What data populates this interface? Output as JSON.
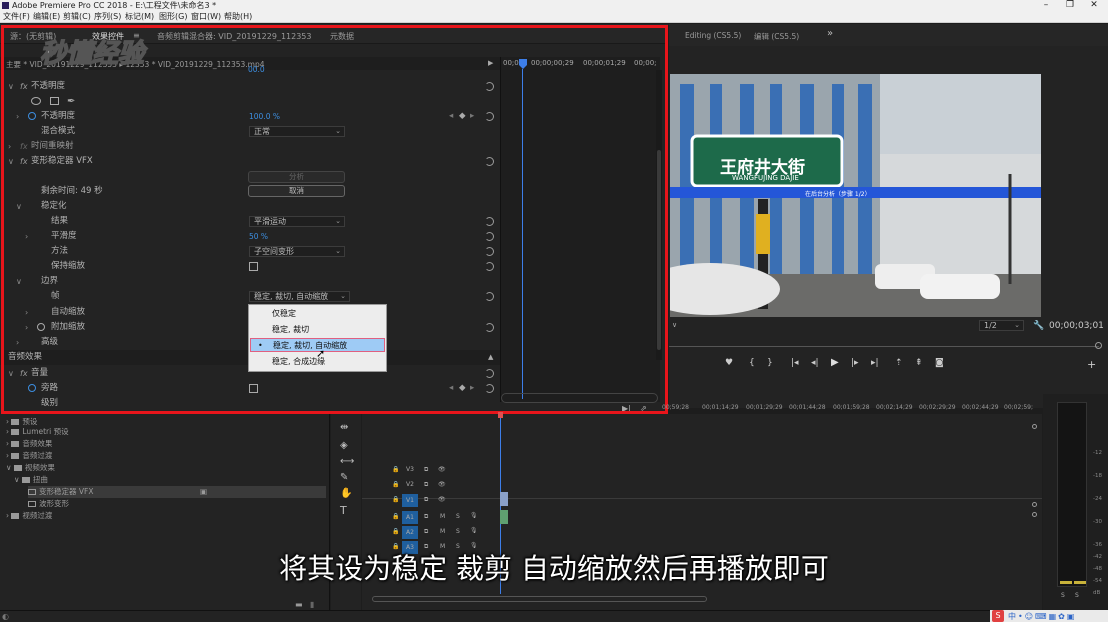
{
  "app": {
    "title": "Adobe Premiere Pro CC 2018 - E:\\工程文件\\未命名3 *"
  },
  "menu": [
    "文件(F)",
    "编辑(E)",
    "剪辑(C)",
    "序列(S)",
    "标记(M)",
    "图形(G)",
    "窗口(W)",
    "帮助(H)"
  ],
  "watermark": "秒懂经验",
  "effect_panel": {
    "tabs": {
      "source": "源：(无剪辑)",
      "effect_controls": "效果控件",
      "menu_icon": "≡",
      "audio_mixer": "音频剪辑混合器: VID_20191229_112353",
      "metadata": "元数据"
    },
    "clip_path": "主要 * VID_20191229_112353 ▸ 12353 * VID_20191229_112353.mp4",
    "timecodes": [
      "00;00",
      "00;00;00;29",
      "00;00;01;29",
      "00;00;"
    ],
    "rows": {
      "top_partial": "00.0",
      "opacity": "不透明度",
      "opacity_label": "不透明度",
      "opacity_value": "100.0 %",
      "blend_mode": "混合模式",
      "blend_mode_value": "正常",
      "time_remap": "时间重映射",
      "warp_stabilizer": "变形稳定器 VFX",
      "analyze_btn": "分析",
      "remaining": "剩余时间: 49 秒",
      "cancel_btn": "取消",
      "stabilization": "稳定化",
      "result": "结果",
      "result_value": "平滑运动",
      "smoothness": "平滑度",
      "smoothness_value": "50 %",
      "method": "方法",
      "method_value": "子空间变形",
      "preserve_scale": "保持缩放",
      "borders": "边界",
      "framing": "帧",
      "framing_value": "稳定, 裁切, 自动缩放",
      "auto_scale": "自动缩放",
      "additional_scale": "附加缩放",
      "advanced": "高级",
      "audio_effects": "音频效果",
      "volume": "音量",
      "bypass": "旁路",
      "level_partial": "级别"
    },
    "framing_menu": {
      "options": [
        "仅稳定",
        "稳定, 裁切",
        "稳定, 裁切, 自动缩放",
        "稳定, 合成边缘"
      ],
      "selected_index": 2
    }
  },
  "program_monitor": {
    "tabs": [
      "Editing (CS5.5)",
      "编辑 (CS5.5)"
    ],
    "overflow": "»",
    "overlay_text": "在后台分析（步骤 1/2）",
    "sign_main": "王府井大街",
    "sign_sub": "WANGFUJING DAJIE",
    "resolution": "1/2",
    "timecode": "00;00;03;01"
  },
  "project_panel": {
    "items": [
      {
        "label": "预设",
        "indent": 0
      },
      {
        "label": "Lumetri 预设",
        "indent": 0
      },
      {
        "label": "音频效果",
        "indent": 0
      },
      {
        "label": "音频过渡",
        "indent": 0
      },
      {
        "label": "视频效果",
        "indent": 0
      },
      {
        "label": "扭曲",
        "indent": 1
      },
      {
        "label": "变形稳定器 VFX",
        "indent": 2
      },
      {
        "label": "波形变形",
        "indent": 2
      },
      {
        "label": "视频过渡",
        "indent": 0
      }
    ]
  },
  "timeline": {
    "ruler": [
      "00;59;28",
      "00;01;14;29",
      "00;01;29;29",
      "00;01;44;28",
      "00;01;59;28",
      "00;02;14;29",
      "00;02;29;29",
      "00;02;44;29",
      "00;02;59;"
    ],
    "video_tracks": [
      "V3",
      "V2",
      "V1"
    ],
    "audio_tracks": [
      "A1",
      "A2",
      "A3"
    ],
    "mute": "M",
    "solo": "S"
  },
  "meter": {
    "scale": [
      "-12",
      "-18",
      "-24",
      "-30",
      "-36",
      "-42",
      "-48",
      "-54",
      "dB"
    ],
    "solo_labels": [
      "S",
      "S"
    ]
  },
  "subtitle": "将其设为稳定 裁剪 自动缩放然后再播放即可",
  "colors": {
    "accent_red": "#e8151b",
    "value_blue": "#3d8ee0",
    "track_blue": "#1f5f9e",
    "playhead": "#3d7ee8"
  }
}
